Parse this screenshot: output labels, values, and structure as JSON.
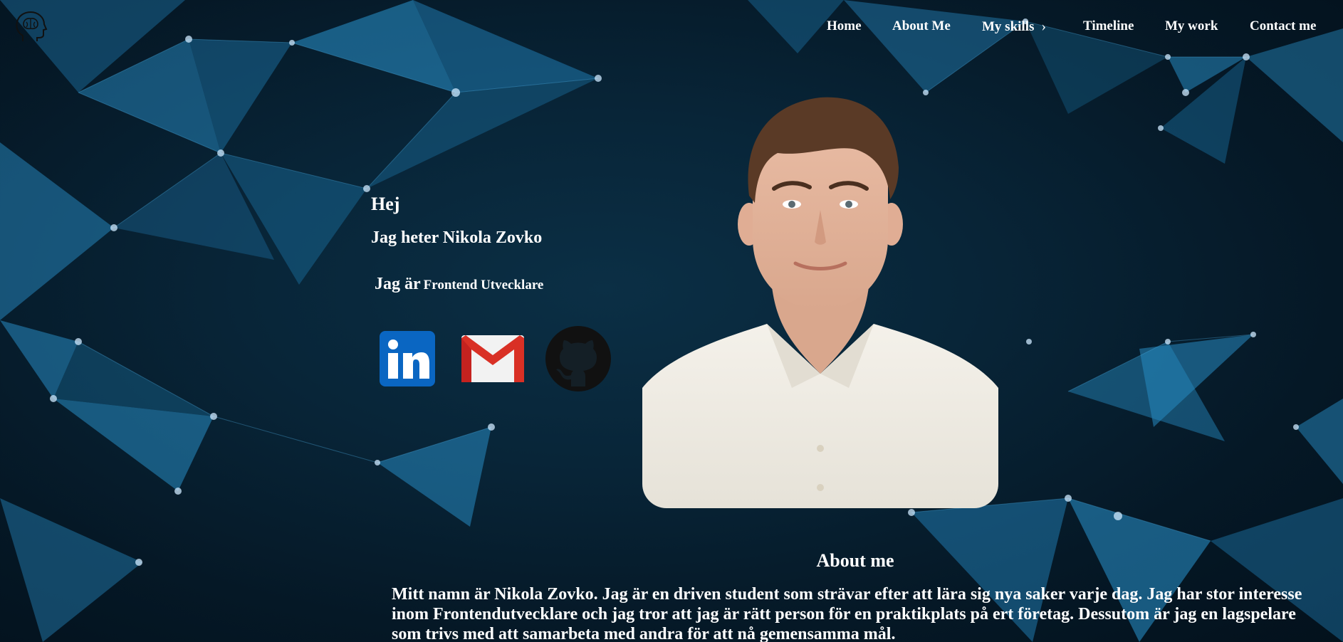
{
  "colors": {
    "background": "#051826",
    "accent_blue": "#2a8fc8",
    "text": "#ffffff",
    "linkedin": "#0a66c2",
    "gmail_red": "#d93025"
  },
  "header": {
    "logo_icon": "head-brain-icon",
    "nav": [
      {
        "label": "Home"
      },
      {
        "label": "About Me"
      },
      {
        "label": "My skills",
        "icon": "chevron-right-icon",
        "chevron": "›"
      },
      {
        "label": "Timeline"
      },
      {
        "label": "My work"
      },
      {
        "label": "Contact me"
      }
    ]
  },
  "hero": {
    "greeting": "Hej",
    "name_line": "Jag heter Nikola Zovko",
    "role_prefix": "Jag är",
    "role_title": "Frontend Utvecklare",
    "social": [
      {
        "name": "LinkedIn",
        "icon": "linkedin-icon"
      },
      {
        "name": "Gmail",
        "icon": "gmail-icon"
      },
      {
        "name": "GitHub",
        "icon": "github-icon"
      }
    ],
    "portrait_icon": "profile-photo"
  },
  "about": {
    "heading": "About me",
    "body": "Mitt namn är Nikola Zovko. Jag är en driven student som strävar efter att lära sig nya saker varje dag. Jag har stor interesse inom Frontendutvecklare och jag tror att jag är rätt person för en praktikplats på ert företag. Dessutom är jag en lagspelare som trivs med att samarbeta med andra för att nå gemensamma mål."
  }
}
